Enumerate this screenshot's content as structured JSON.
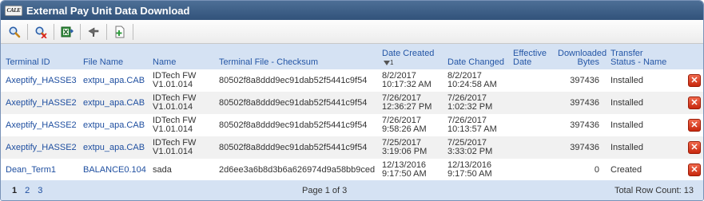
{
  "app": {
    "title": "External Pay Unit Data Download",
    "logo_text": "CALE"
  },
  "toolbar": {
    "buttons": [
      {
        "icon": "search-icon",
        "name": "search"
      },
      {
        "icon": "clear-search-icon",
        "name": "clear-search"
      },
      {
        "icon": "export-excel-icon",
        "name": "export"
      },
      {
        "icon": "send-icon",
        "name": "send"
      },
      {
        "icon": "add-document-icon",
        "name": "add"
      }
    ]
  },
  "columns": {
    "terminal_id": "Terminal ID",
    "file_name": "File Name",
    "name": "Name",
    "checksum": "Terminal File - Checksum",
    "date_created": "Date Created",
    "date_created_sort_index": "1",
    "date_changed": "Date Changed",
    "effective_date_1": "Effective",
    "effective_date_2": "Date",
    "downloaded_bytes_1": "Downloaded",
    "downloaded_bytes_2": "Bytes",
    "transfer_status_1": "Transfer",
    "transfer_status_2": "Status - Name"
  },
  "rows": [
    {
      "terminal_id": "Axeptify_HASSE3",
      "file_name": "extpu_apa.CAB",
      "name_1": "IDTech FW",
      "name_2": "V1.01.014",
      "checksum": "80502f8a8ddd9ec91dab52f5441c9f54",
      "created_1": "8/2/2017",
      "created_2": "10:17:32 AM",
      "changed_1": "8/2/2017",
      "changed_2": "10:24:58 AM",
      "effective": "",
      "bytes": "397436",
      "status": "Installed"
    },
    {
      "terminal_id": "Axeptify_HASSE2",
      "file_name": "extpu_apa.CAB",
      "name_1": "IDTech FW",
      "name_2": "V1.01.014",
      "checksum": "80502f8a8ddd9ec91dab52f5441c9f54",
      "created_1": "7/26/2017",
      "created_2": "12:36:27 PM",
      "changed_1": "7/26/2017",
      "changed_2": "1:02:32 PM",
      "effective": "",
      "bytes": "397436",
      "status": "Installed"
    },
    {
      "terminal_id": "Axeptify_HASSE2",
      "file_name": "extpu_apa.CAB",
      "name_1": "IDTech FW",
      "name_2": "V1.01.014",
      "checksum": "80502f8a8ddd9ec91dab52f5441c9f54",
      "created_1": "7/26/2017",
      "created_2": "9:58:26 AM",
      "changed_1": "7/26/2017",
      "changed_2": "10:13:57 AM",
      "effective": "",
      "bytes": "397436",
      "status": "Installed"
    },
    {
      "terminal_id": "Axeptify_HASSE2",
      "file_name": "extpu_apa.CAB",
      "name_1": "IDTech FW",
      "name_2": "V1.01.014",
      "checksum": "80502f8a8ddd9ec91dab52f5441c9f54",
      "created_1": "7/25/2017",
      "created_2": "3:19:06 PM",
      "changed_1": "7/25/2017",
      "changed_2": "3:33:02 PM",
      "effective": "",
      "bytes": "397436",
      "status": "Installed"
    },
    {
      "terminal_id": "Dean_Term1",
      "file_name": "BALANCE0.104",
      "name_1": "sada",
      "name_2": "",
      "checksum": "2d6ee3a6b8d3b6a626974d9a58bb9ced",
      "created_1": "12/13/2016",
      "created_2": "9:17:50 AM",
      "changed_1": "12/13/2016",
      "changed_2": "9:17:50 AM",
      "effective": "",
      "bytes": "0",
      "status": "Created"
    }
  ],
  "footer": {
    "pages": [
      "1",
      "2",
      "3"
    ],
    "current_page": "1",
    "page_of": "Page 1 of 3",
    "total": "Total Row Count: 13"
  },
  "colors": {
    "title_bar": "#3d5f87",
    "header_bg": "#d5e2f3",
    "link": "#1f4fa0",
    "delete": "#d9381a"
  }
}
